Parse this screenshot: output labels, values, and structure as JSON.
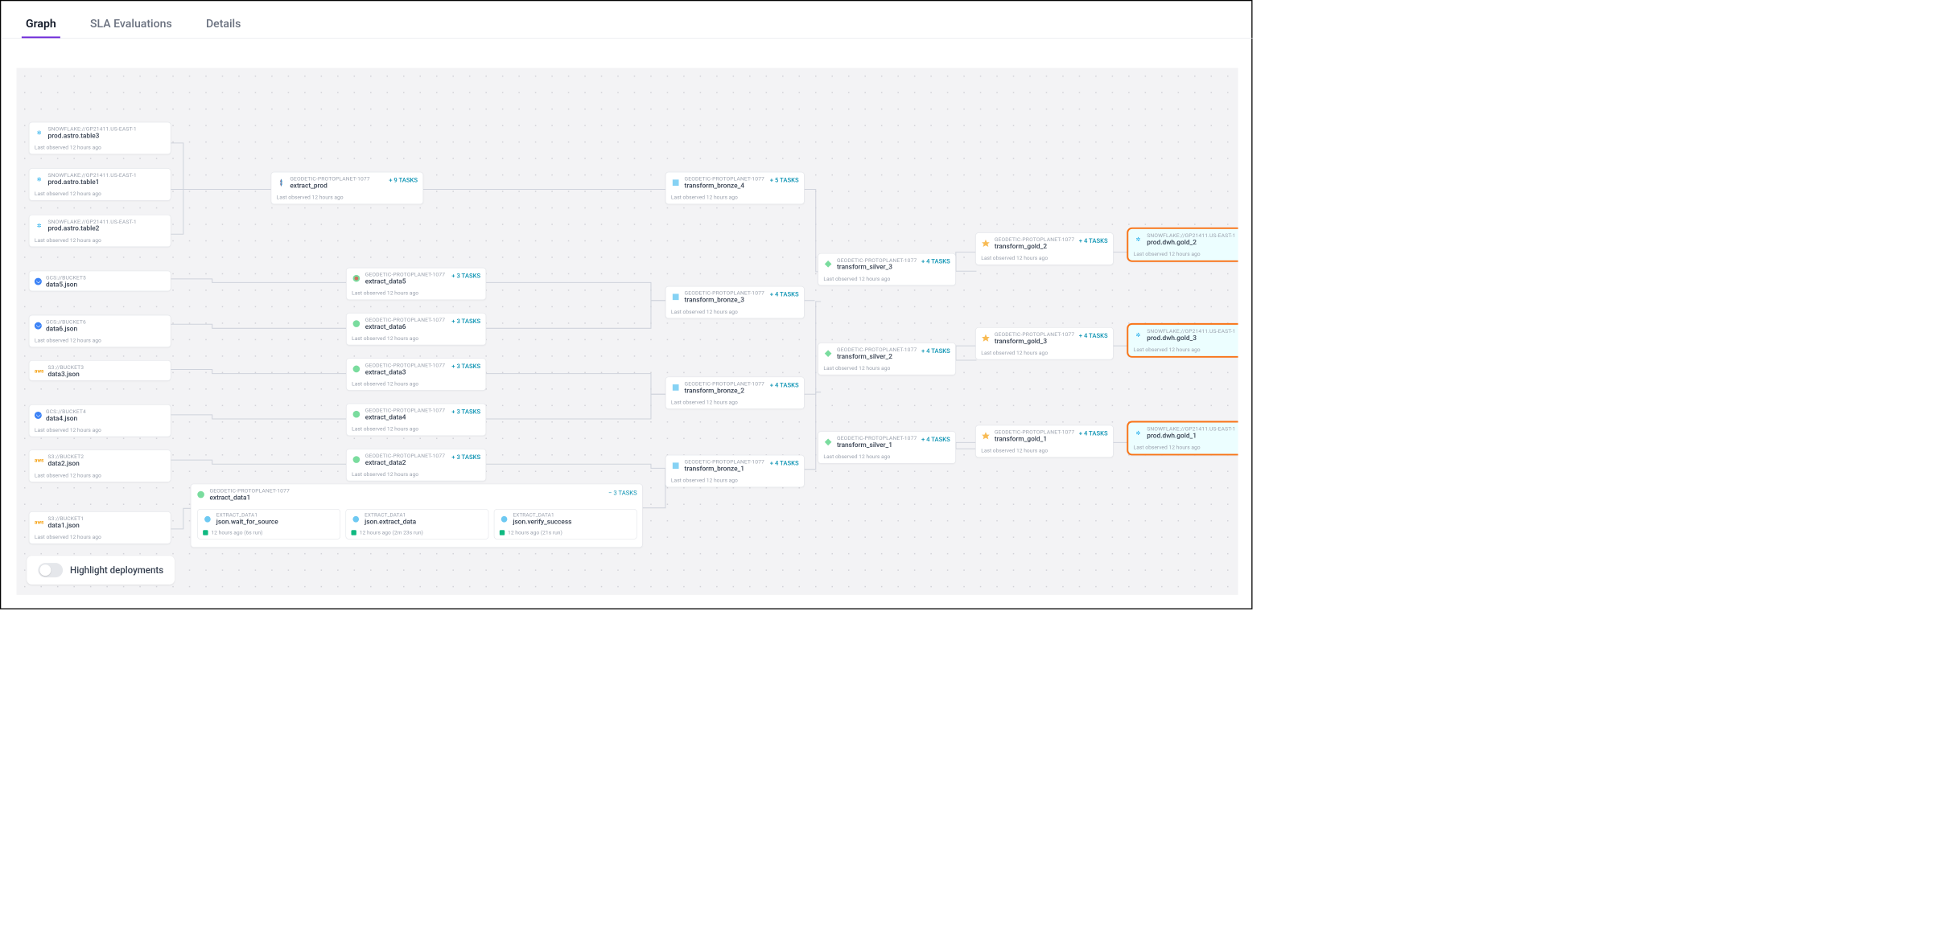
{
  "tabs": [
    "Graph",
    "SLA Evaluations",
    "Details"
  ],
  "active_tab": 0,
  "sources": {
    "sf": "SNOWFLAKE://GP21411.US-EAST-1",
    "geo": "GEODETIC-PROTOPLANET-1077",
    "gcs5": "GCS://BUCKET5",
    "gcs6": "GCS://BUCKET6",
    "gcs4": "GCS://BUCKET4",
    "s3_3": "S3://BUCKET3",
    "s3_2": "S3://BUCKET2",
    "s3_1": "S3://BUCKET1",
    "ed1": "EXTRACT_DATA1"
  },
  "obs": "Last observed 12 hours ago",
  "tasks_label": {
    "9": "+ 9 TASKS",
    "5": "+ 5 TASKS",
    "4": "+ 4 TASKS",
    "3": "+ 3 TASKS",
    "m3": "− 3 TASKS"
  },
  "nodes": {
    "t3": "prod.astro.table3",
    "t1": "prod.astro.table1",
    "t2": "prod.astro.table2",
    "ep": "extract_prod",
    "d5": "data5.json",
    "d6": "data6.json",
    "d3": "data3.json",
    "d4": "data4.json",
    "d2": "data2.json",
    "d1": "data1.json",
    "ed5": "extract_data5",
    "ed6": "extract_data6",
    "ed3": "extract_data3",
    "ed4": "extract_data4",
    "ed2": "extract_data2",
    "ed1": "extract_data1",
    "tb4": "transform_bronze_4",
    "tb3": "transform_bronze_3",
    "tb2": "transform_bronze_2",
    "tb1": "transform_bronze_1",
    "ts3": "transform_silver_3",
    "ts2": "transform_silver_2",
    "ts1": "transform_silver_1",
    "tg2": "transform_gold_2",
    "tg3": "transform_gold_3",
    "tg1": "transform_gold_1",
    "g2": "prod.dwh.gold_2",
    "g3": "prod.dwh.gold_3",
    "g1": "prod.dwh.gold_1",
    "wf": "json.wait_for_source",
    "je": "json.extract_data",
    "jv": "json.verify_success"
  },
  "runs": {
    "wf": "12 hours ago (6s run)",
    "je": "12 hours ago (2m 23s run)",
    "jv": "12 hours ago (21s run)"
  },
  "toggle": {
    "label": "Highlight deployments"
  }
}
